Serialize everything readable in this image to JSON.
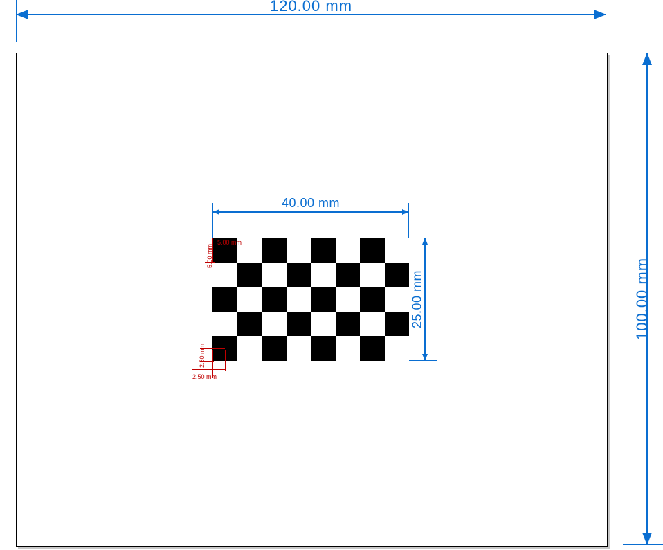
{
  "page": {
    "width_label": "120.00 mm",
    "height_label": "100.00 mm",
    "width_mm": 120.0,
    "height_mm": 100.0
  },
  "pattern": {
    "width_label": "40.00 mm",
    "height_label": "25.00 mm",
    "width_mm": 40.0,
    "height_mm": 25.0,
    "cols": 8,
    "rows": 5
  },
  "square": {
    "width_label": "5.00 mm",
    "height_label": "5.00 mm",
    "size_mm": 5.0
  },
  "corner": {
    "width_label": "2.50 mm",
    "height_label": "2.50 mm",
    "size_mm": 2.5
  },
  "colors": {
    "dimension": "#0a6ed1",
    "detail": "#c00000",
    "paper": "#ffffff"
  }
}
